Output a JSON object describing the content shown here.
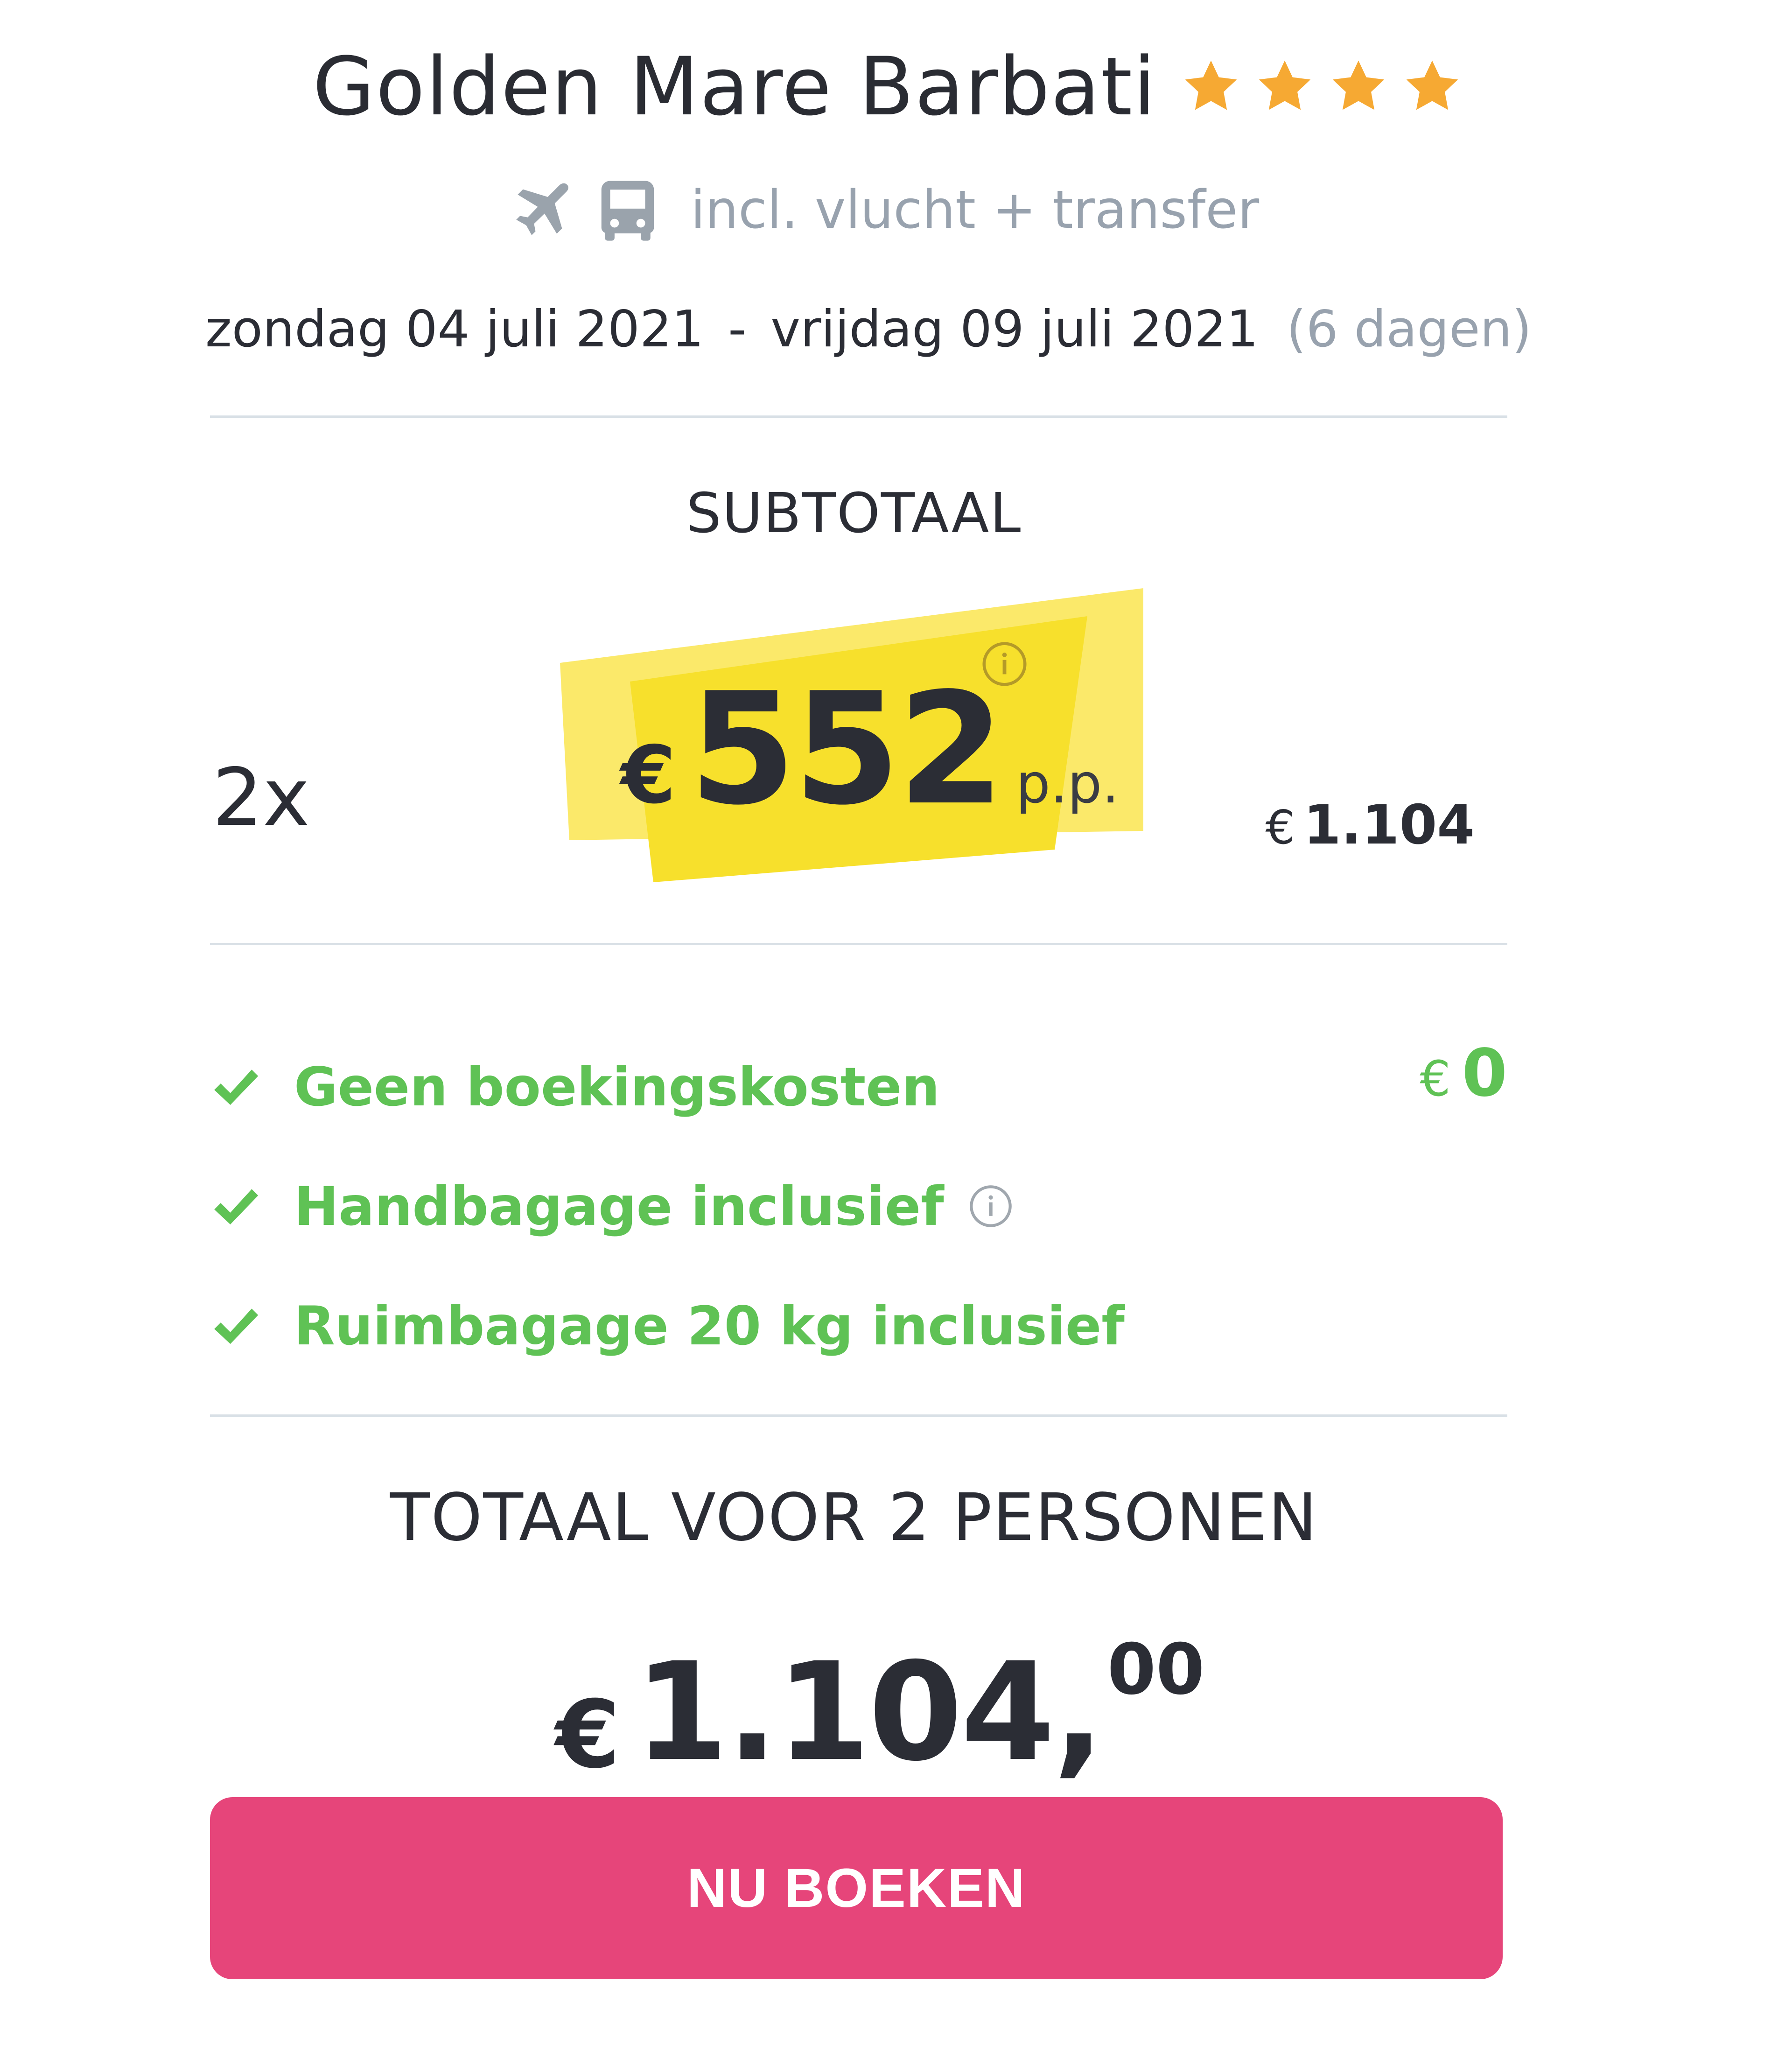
{
  "header": {
    "hotel_name": "Golden Mare Barbati",
    "star_rating": 4,
    "star_icon": "star-icon",
    "included_icons": [
      "airplane-icon",
      "bus-icon"
    ],
    "included_text": "incl. vlucht + transfer"
  },
  "dates": {
    "start": "zondag 04 juli 2021",
    "separator": "-",
    "end": "vrijdag 09 juli 2021",
    "duration": "(6 dagen)"
  },
  "subtotal": {
    "title": "SUBTOTAAL",
    "persons": "2x",
    "currency": "€",
    "price_per_person": "552",
    "per_person_label": "p.p.",
    "info_icon": "info-icon",
    "row_total_currency": "€",
    "row_total": "1.104"
  },
  "features": [
    {
      "label": "Geen boekingskosten",
      "icon": "check-icon",
      "fee_currency": "€",
      "fee": "0"
    },
    {
      "label": "Handbagage inclusief",
      "icon": "check-icon",
      "info_icon": "info-icon"
    },
    {
      "label": "Ruimbagage 20 kg inclusief",
      "icon": "check-icon"
    }
  ],
  "total": {
    "title": "TOTAAL VOOR 2 PERSONEN",
    "currency": "€",
    "amount": "1.104,",
    "cents": "00"
  },
  "cta": {
    "label": "NU BOEKEN"
  },
  "colors": {
    "text": "#2b2d35",
    "muted": "#98a2ae",
    "star": "#f6a933",
    "highlight": "#f9e43a",
    "success": "#5fc255",
    "cta": "#e6457a",
    "divider": "#d9e0e6"
  }
}
